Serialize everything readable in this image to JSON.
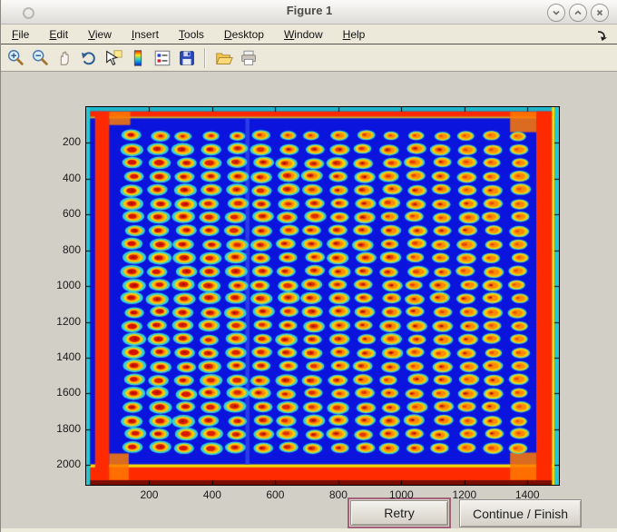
{
  "window": {
    "title": "Figure 1",
    "controls": [
      {
        "name": "shade-window",
        "glyph": "chevron-down"
      },
      {
        "name": "maximize-window",
        "glyph": "chevron-up"
      },
      {
        "name": "close-window",
        "glyph": "x"
      }
    ]
  },
  "menu": {
    "items": [
      {
        "id": "file",
        "label": "File"
      },
      {
        "id": "edit",
        "label": "Edit"
      },
      {
        "id": "view",
        "label": "View"
      },
      {
        "id": "insert",
        "label": "Insert"
      },
      {
        "id": "tools",
        "label": "Tools"
      },
      {
        "id": "desktop",
        "label": "Desktop"
      },
      {
        "id": "window",
        "label": "Window"
      },
      {
        "id": "help",
        "label": "Help"
      }
    ],
    "dock_icon": "dock-figure-arrow-icon"
  },
  "toolbar": {
    "icons": [
      "zoom-in",
      "zoom-out",
      "pan",
      "rotate-3d",
      "data-cursor",
      "insert-colorbar",
      "insert-legend",
      "save-figure",
      "separator",
      "open-file",
      "print-figure"
    ]
  },
  "buttons": {
    "retry": {
      "label": "Retry",
      "highlight_color": "#a2607b"
    },
    "continue": {
      "label": "Continue / Finish"
    }
  },
  "chart_data": {
    "type": "heatmap",
    "title": "",
    "xlabel": "",
    "ylabel": "",
    "description": "Jet-colormap camera image of a 384-well microplate: 24 rows x 16 columns of spots with red/orange centers, yellow rings and cyan halos on a royal-blue background; bright red bands along the plate edges; y axis increases downward (image coordinates)",
    "x_ticks": [
      200,
      400,
      600,
      800,
      1000,
      1200,
      1400
    ],
    "y_ticks": [
      200,
      400,
      600,
      800,
      1000,
      1200,
      1400,
      1600,
      1800,
      2000
    ],
    "x_range": [
      0,
      1500
    ],
    "y_range": [
      0,
      2110
    ],
    "grid": {
      "rows": 24,
      "cols": 16,
      "first_x": 150,
      "pitch_x": 81.5,
      "first_y": 160,
      "pitch_y": 75.8,
      "halo_radius": 31,
      "body_radius": 25,
      "mid_radius": 17,
      "red_radius": 11,
      "seed": 7
    },
    "palette": {
      "background": "#0a14dd",
      "seam": "#2a3ce8",
      "halo": "#35d2d8",
      "body_yellow": "#ffd400",
      "mid_orange": "#ff8a00",
      "red_left": "#d40f00",
      "red_right": "#ea5500",
      "speck": "#8f0800",
      "border_red": "#ff2a00",
      "border_maroon": "#7a0d00",
      "edge_cyan": "#25c8d2",
      "edge_teal": "#1fb6c9",
      "edge_yellow": "#ffe000",
      "foot_orange": "#ff7a00",
      "axis": "#000000"
    },
    "bands": [
      [
        "edge_teal",
        0,
        0,
        1500,
        24
      ],
      [
        "border_red",
        0,
        24,
        1500,
        52
      ],
      [
        "mid_orange",
        0,
        52,
        1500,
        57
      ],
      [
        "edge_yellow",
        0,
        57,
        1500,
        62
      ],
      [
        "edge_yellow",
        0,
        1996,
        1500,
        2013
      ],
      [
        "border_red",
        0,
        2013,
        1500,
        2085
      ],
      [
        "border_maroon",
        0,
        2085,
        1500,
        2110
      ],
      [
        "border_red",
        28,
        24,
        73,
        2085
      ],
      [
        "border_red",
        1428,
        24,
        1478,
        2085
      ],
      [
        "foot_orange",
        73,
        26,
        140,
        100
      ],
      [
        "foot_orange",
        1345,
        26,
        1428,
        140
      ],
      [
        "foot_orange",
        73,
        1935,
        135,
        2083
      ],
      [
        "foot_orange",
        1345,
        1930,
        1428,
        2083
      ],
      [
        "edge_cyan",
        0,
        0,
        12,
        2110
      ],
      [
        "edge_yellow",
        1478,
        0,
        1486,
        2110
      ],
      [
        "edge_cyan",
        1486,
        0,
        1500,
        2110
      ],
      [
        "seam",
        505,
        62,
        518,
        1996
      ]
    ]
  }
}
